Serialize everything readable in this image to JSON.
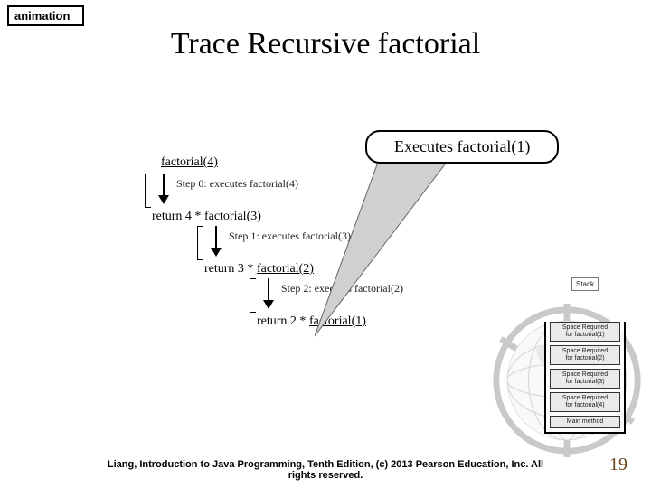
{
  "tag": {
    "label": "animation"
  },
  "title": "Trace Recursive factorial",
  "callout": {
    "text": "Executes factorial(1)"
  },
  "trace": {
    "start_call": "factorial(4)",
    "steps": [
      {
        "label": "Step 0: executes factorial(4)",
        "ret_prefix": "return 4 * ",
        "ret_call": "factorial(3)"
      },
      {
        "label": "Step 1: executes factorial(3)",
        "ret_prefix": "return 3 * ",
        "ret_call": "factorial(2)"
      },
      {
        "label": "Step 2: executes factorial(2)",
        "ret_prefix": "return 2 * ",
        "ret_call": "factorial(1)"
      }
    ]
  },
  "stack": {
    "title": "Stack",
    "frames": [
      {
        "line1": "Space Required",
        "line2": "for factorial(1)"
      },
      {
        "line1": "Space Required",
        "line2": "for factorial(2)"
      },
      {
        "line1": "Space Required",
        "line2": "for factorial(3)"
      },
      {
        "line1": "Space Required",
        "line2": "for factorial(4)"
      },
      {
        "line1": "Main method",
        "line2": ""
      }
    ]
  },
  "footer": {
    "line1": "Liang, Introduction to Java Programming, Tenth Edition, (c) 2013 Pearson Education, Inc. All",
    "line2": "rights reserved."
  },
  "page_number": "19"
}
